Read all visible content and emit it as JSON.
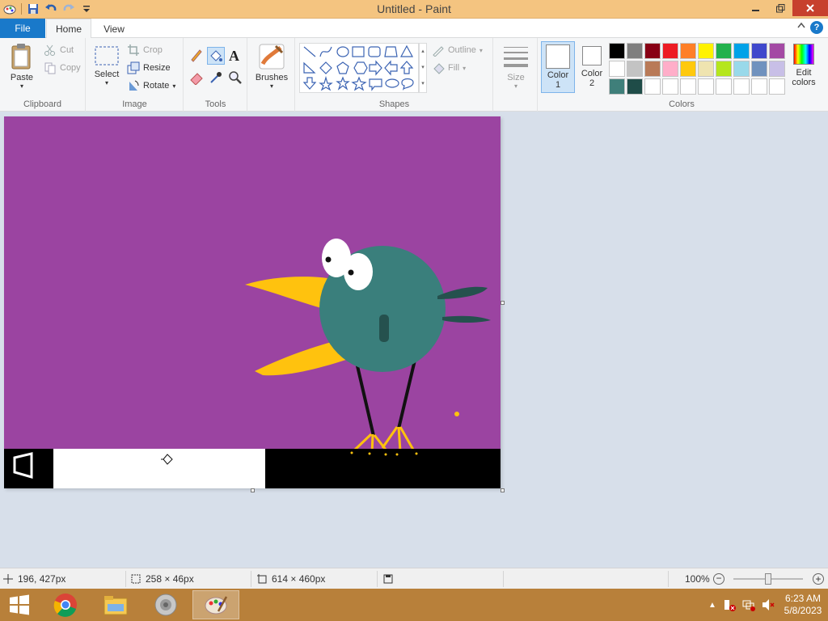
{
  "window": {
    "title": "Untitled - Paint"
  },
  "tabs": {
    "file": "File",
    "home": "Home",
    "view": "View"
  },
  "clipboard": {
    "paste": "Paste",
    "cut": "Cut",
    "copy": "Copy",
    "label": "Clipboard"
  },
  "image": {
    "select": "Select",
    "crop": "Crop",
    "resize": "Resize",
    "rotate": "Rotate",
    "label": "Image"
  },
  "tools": {
    "label": "Tools"
  },
  "brushes": {
    "label": "Brushes"
  },
  "shapes": {
    "outline": "Outline",
    "fill": "Fill",
    "label": "Shapes"
  },
  "size": {
    "label": "Size"
  },
  "colors": {
    "color1": "Color",
    "color1_num": "1",
    "color2": "Color",
    "color2_num": "2",
    "edit1": "Edit",
    "edit2": "colors",
    "label": "Colors",
    "palette": [
      "#000000",
      "#7f7f7f",
      "#880015",
      "#ed1c24",
      "#ff7f27",
      "#fff200",
      "#22b14c",
      "#00a2e8",
      "#3f48cc",
      "#a349a4",
      "#ffffff",
      "#c3c3c3",
      "#b97a57",
      "#ffaec9",
      "#ffc90e",
      "#efe4b0",
      "#b5e61d",
      "#99d9ea",
      "#7092be",
      "#c8bfe7",
      "#3f7f7a",
      "#1f4c48",
      "#ffffff",
      "#ffffff",
      "#ffffff",
      "#ffffff",
      "#ffffff",
      "#ffffff",
      "#ffffff",
      "#ffffff"
    ]
  },
  "canvas": {
    "background": "#9b44a1",
    "bird_body": "#3a7f7c",
    "beak": "#ffc20e"
  },
  "status": {
    "cursor_pos": "196, 427px",
    "selection_size": "258 × 46px",
    "image_size": "614 × 460px",
    "zoom": "100%"
  },
  "taskbar": {
    "time": "6:23 AM",
    "date": "5/8/2023"
  }
}
